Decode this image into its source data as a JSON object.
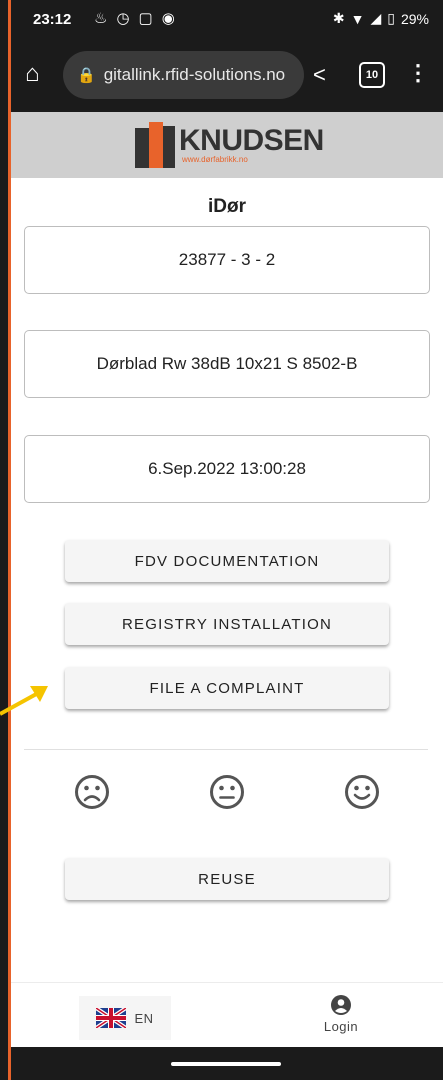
{
  "status_bar": {
    "time": "23:12",
    "battery": "29%",
    "icons": [
      "notification-icon",
      "alarm-icon",
      "cast-icon",
      "app-icon",
      "bluetooth-icon",
      "wifi-icon",
      "signal-icon",
      "battery-icon"
    ]
  },
  "browser": {
    "url": "gitallink.rfid-solutions.no",
    "tab_count": "10"
  },
  "brand": {
    "name": "KNUDSEN",
    "url": "www.dørfabrikk.no",
    "accent": "#e8632b"
  },
  "page": {
    "title": "iDør",
    "fields": [
      {
        "value": "23877 - 3 - 2"
      },
      {
        "value": "Dørblad Rw 38dB 10x21  S 8502-B"
      },
      {
        "value": "6.Sep.2022 13:00:28"
      }
    ],
    "buttons": {
      "fdv": "FDV DOCUMENTATION",
      "registry": "REGISTRY INSTALLATION",
      "complaint": "FILE A COMPLAINT",
      "reuse": "REUSE"
    },
    "ratings": [
      "sad-face-icon",
      "neutral-face-icon",
      "happy-face-icon"
    ]
  },
  "footer": {
    "language": "EN",
    "login": "Login"
  },
  "annotation": {
    "arrow_color": "#f5c400"
  }
}
